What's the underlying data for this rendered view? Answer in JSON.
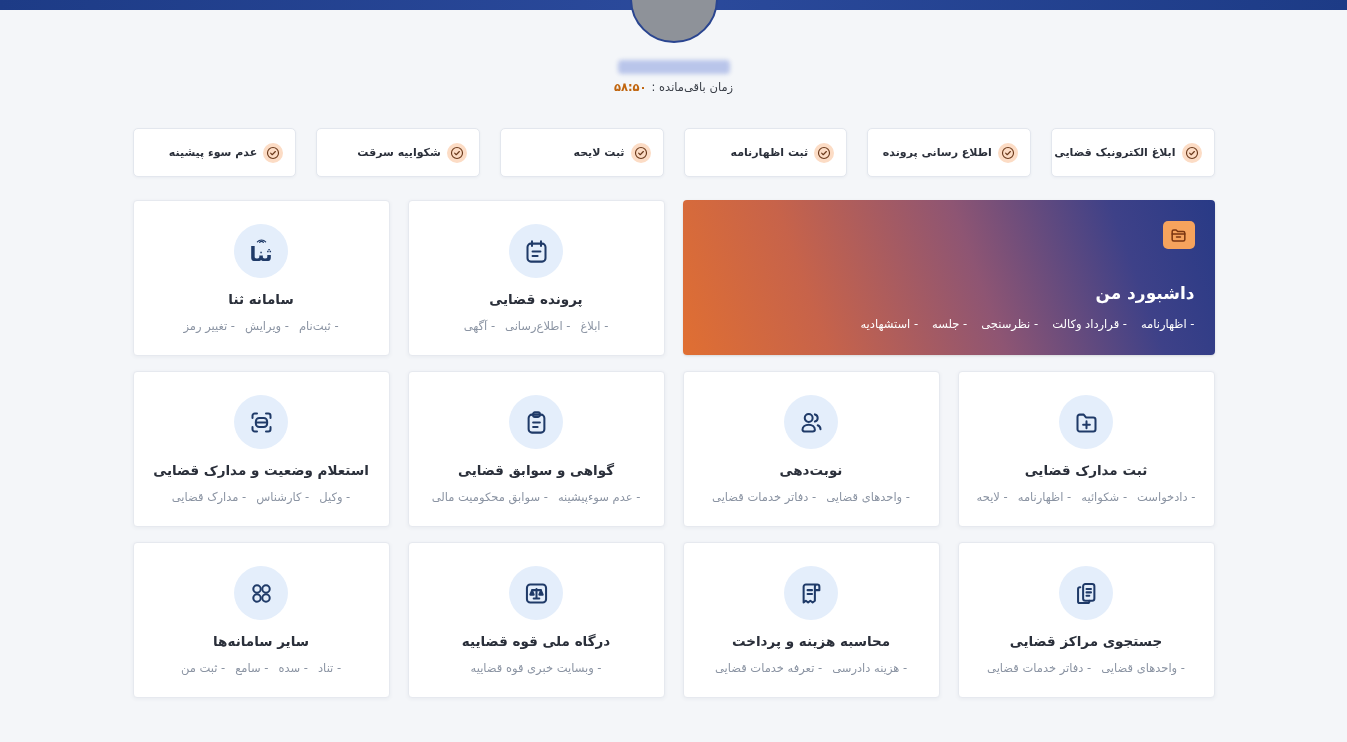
{
  "header": {
    "timer_label": "زمان باقی‌مانده :",
    "timer_value": "۵۸:۵۰"
  },
  "quick_links": [
    "ابلاغ الکترونیک قضایی",
    "اطلاع رسانی پرونده",
    "ثبت اظهارنامه",
    "ثبت لایحه",
    "شکواییه سرقت",
    "عدم سوء پیشینه"
  ],
  "cards": [
    {
      "kind": "dashboard",
      "title": "داشبورد من",
      "items": [
        "- اظهارنامه",
        "- قرارداد وکالت",
        "- نظرسنجی",
        "- جلسه",
        "- استشهادیه"
      ]
    },
    {
      "kind": "service",
      "title": "پرونده قضایی",
      "items": [
        "- ابلاغ",
        "- اطلاع‌رسانی",
        "- آگهی"
      ]
    },
    {
      "kind": "logo",
      "logo": "ثنا",
      "title": "سامانه ثنا",
      "items": [
        "- ثبت‌نام",
        "- ویرایش",
        "- تغییر رمز"
      ]
    },
    {
      "kind": "service",
      "title": "ثبت مدارک قضایی",
      "items": [
        "- دادخواست",
        "- شکوائیه",
        "- اظهارنامه",
        "- لایحه"
      ]
    },
    {
      "kind": "service",
      "title": "نوبت‌دهی",
      "items": [
        "- واحدهای قضایی",
        "- دفاتر خدمات قضایی"
      ]
    },
    {
      "kind": "service",
      "title": "گواهی و سوابق قضایی",
      "items": [
        "- عدم سوء‌پیشینه",
        "- سوابق محکومیت مالی"
      ]
    },
    {
      "kind": "service",
      "title": "استعلام وضعیت و مدارک قضایی",
      "items": [
        "- وکیل",
        "- کارشناس",
        "- مدارک قضایی"
      ]
    },
    {
      "kind": "service",
      "title": "جستجوی مراکز قضایی",
      "items": [
        "- واحدهای قضایی",
        "- دفاتر خدمات قضایی"
      ]
    },
    {
      "kind": "service",
      "title": "محاسبه هزینه و پرداخت",
      "items": [
        "- هزینه دادرسی",
        "- تعرفه خدمات قضایی"
      ]
    },
    {
      "kind": "service",
      "title": "درگاه ملی قوه قضاییه",
      "items": [
        "- وبسایت خبری قوه قضاییه"
      ]
    },
    {
      "kind": "service",
      "title": "سایر سامانه‌ها",
      "items": [
        "- تناد",
        "- سده",
        "- سامع",
        "- ثبت من"
      ]
    }
  ]
}
